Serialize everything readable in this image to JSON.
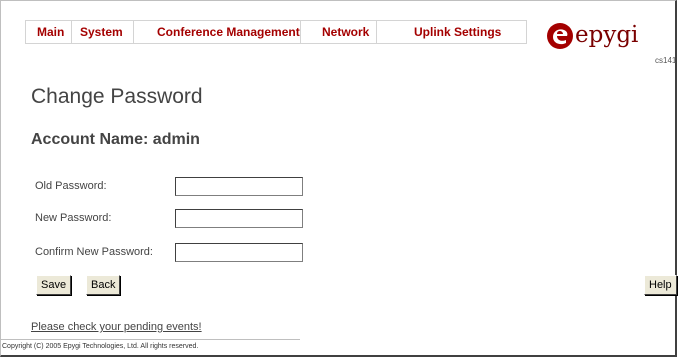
{
  "nav": {
    "items": [
      {
        "label": "Main"
      },
      {
        "label": "System"
      },
      {
        "label": "Conference Management"
      },
      {
        "label": "Network"
      },
      {
        "label": "Uplink Settings"
      }
    ]
  },
  "brand": {
    "logo_text": "epygi",
    "code": "cs141",
    "color": "#a40000"
  },
  "page": {
    "title": "Change Password",
    "account_label": "Account Name: admin"
  },
  "form": {
    "old_password": {
      "label": "Old Password:",
      "value": ""
    },
    "new_password": {
      "label": "New Password:",
      "value": ""
    },
    "confirm_password": {
      "label": "Confirm New Password:",
      "value": ""
    }
  },
  "buttons": {
    "save": "Save",
    "back": "Back",
    "help": "Help"
  },
  "footer": {
    "pending_link": "Please check your pending events!",
    "copyright": "Copyright (C) 2005 Epygi Technologies, Ltd. All rights reserved."
  }
}
